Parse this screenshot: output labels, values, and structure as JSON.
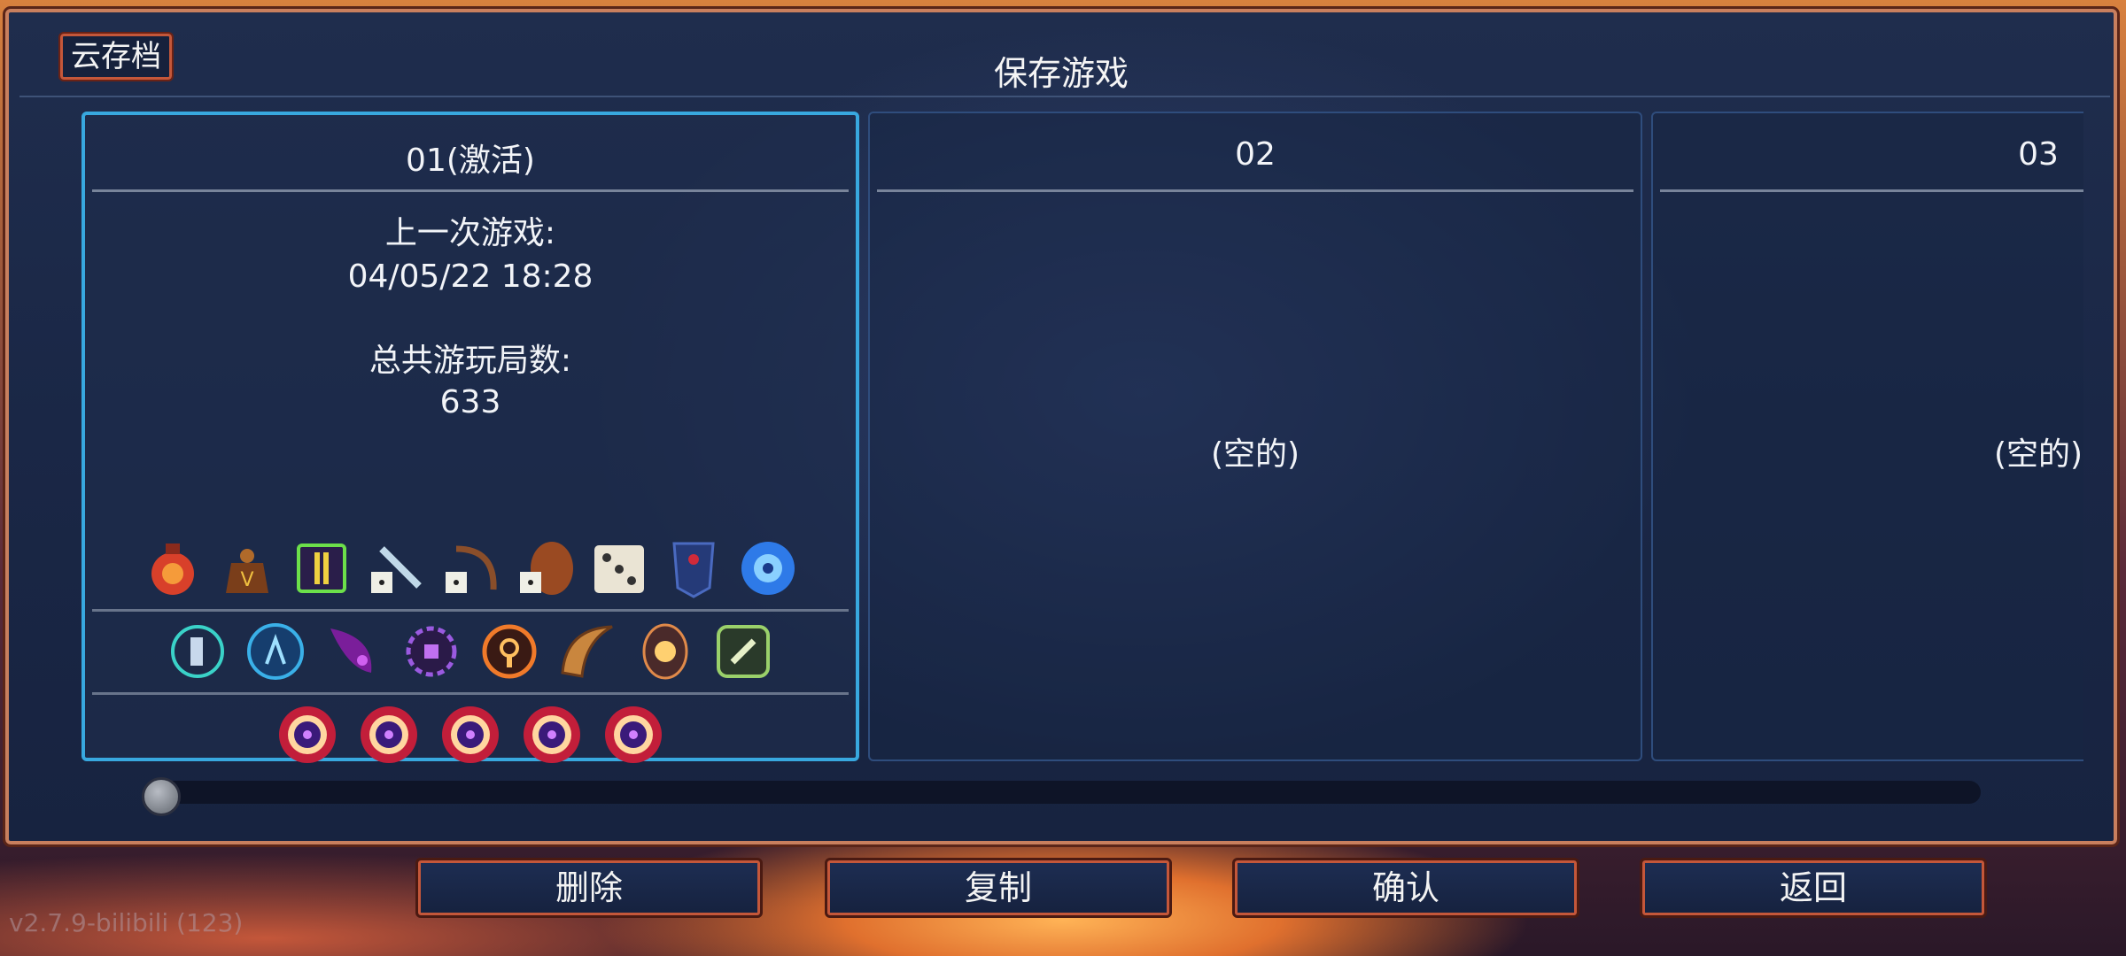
{
  "header": {
    "cloud_button": "云存档",
    "title": "保存游戏"
  },
  "slots": [
    {
      "label": "01(激活)",
      "active": true,
      "last_played_label": "上一次游戏:",
      "last_played_value": "04/05/22  18:28",
      "runs_label": "总共游玩局数:",
      "runs_value": "633",
      "items_row1": [
        "red-potion-icon",
        "gold-bag-icon",
        "scroll-upgrade-icon",
        "dice-blade-icon",
        "dice-bow-icon",
        "dice-shield-icon",
        "dice-icon",
        "dark-shield-icon",
        "blue-orb-icon"
      ],
      "items_row2": [
        "cyan-rune-icon",
        "blue-rune-icon",
        "purple-claw-icon",
        "purple-gear-icon",
        "orange-rune-icon",
        "horn-icon",
        "sun-rune-icon",
        "green-bone-icon"
      ],
      "items_row3": [
        "boss-cell-icon",
        "boss-cell-icon",
        "boss-cell-icon",
        "boss-cell-icon",
        "boss-cell-icon"
      ]
    },
    {
      "label": "02",
      "active": false,
      "empty_text": "(空的)"
    },
    {
      "label": "03",
      "active": false,
      "empty_text": "(空的)"
    }
  ],
  "scrollbar": {
    "position": 0
  },
  "actions": {
    "delete": "删除",
    "copy": "复制",
    "confirm": "确认",
    "back": "返回"
  },
  "footer": {
    "version": "v2.7.9-bilibili (123)"
  },
  "colors": {
    "active_border": "#38a8df",
    "button_border": "#c4573a",
    "panel_bg": "#1a2746"
  }
}
